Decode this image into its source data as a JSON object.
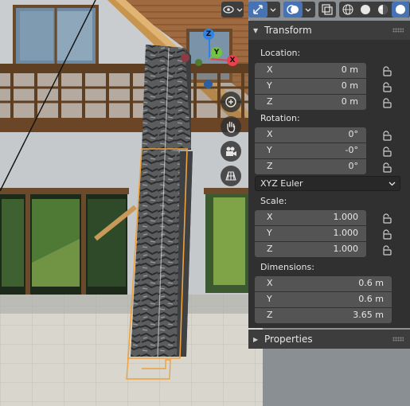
{
  "header": {
    "viewport_shading": {
      "options": [
        "wireframe",
        "solid",
        "material-preview",
        "rendered"
      ],
      "active": "rendered"
    }
  },
  "gizmo": {
    "axes": {
      "x": "X",
      "y": "Y",
      "z": "Z"
    },
    "colors": {
      "x": "#e8414f",
      "y": "#72c33d",
      "z": "#2e82e6"
    }
  },
  "transform": {
    "title": "Transform",
    "location": {
      "label": "Location:",
      "x": {
        "label": "X",
        "value": "0 m"
      },
      "y": {
        "label": "Y",
        "value": "0 m"
      },
      "z": {
        "label": "Z",
        "value": "0 m"
      }
    },
    "rotation": {
      "label": "Rotation:",
      "x": {
        "label": "X",
        "value": "0°"
      },
      "y": {
        "label": "Y",
        "value": "-0°"
      },
      "z": {
        "label": "Z",
        "value": "0°"
      },
      "mode": "XYZ Euler"
    },
    "scale": {
      "label": "Scale:",
      "x": {
        "label": "X",
        "value": "1.000"
      },
      "y": {
        "label": "Y",
        "value": "1.000"
      },
      "z": {
        "label": "Z",
        "value": "1.000"
      }
    },
    "dimensions": {
      "label": "Dimensions:",
      "x": {
        "label": "X",
        "value": "0.6 m"
      },
      "y": {
        "label": "Y",
        "value": "0.6 m"
      },
      "z": {
        "label": "Z",
        "value": "3.65 m"
      }
    }
  },
  "properties": {
    "title": "Properties"
  },
  "colors": {
    "accent": "#4772b3",
    "selection_outline": "#f0a13a",
    "panel_bg": "#303030",
    "field_bg": "#545454"
  }
}
